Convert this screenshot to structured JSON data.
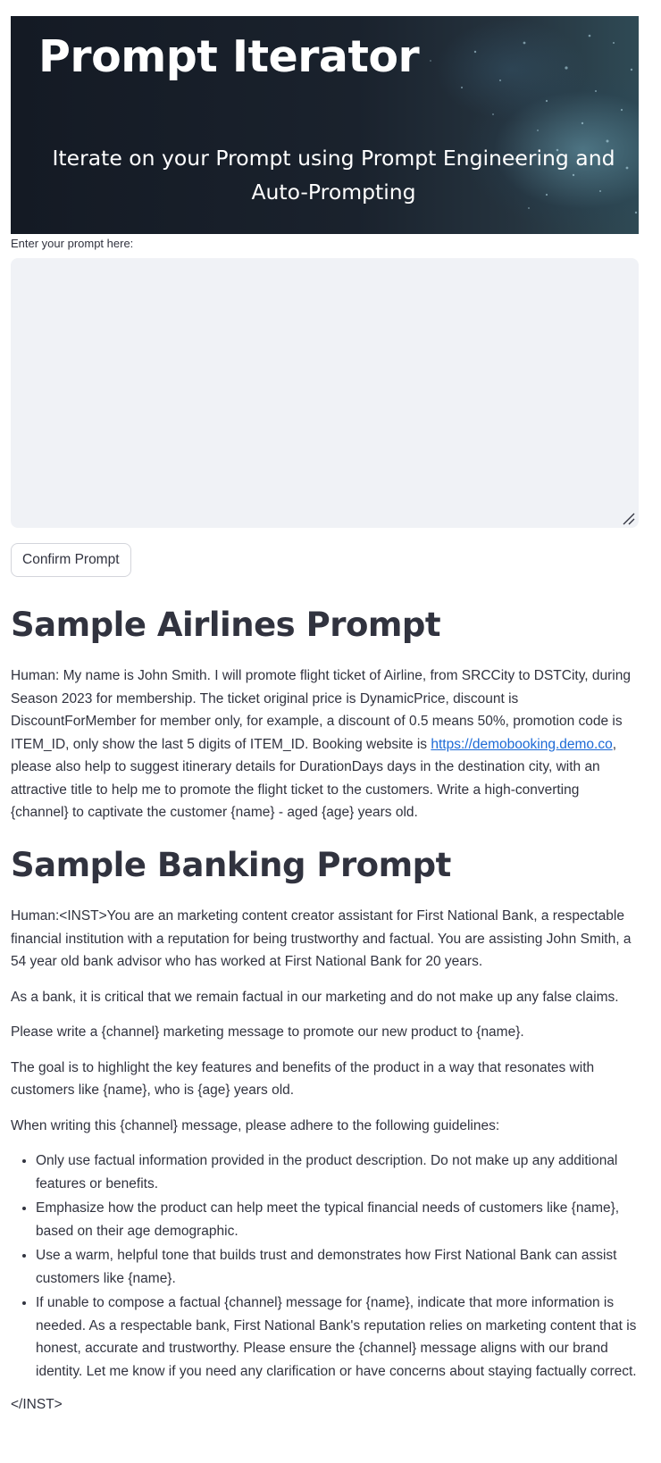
{
  "header": {
    "title": "Prompt Iterator",
    "subtitle": "Iterate on your Prompt using Prompt Engineering and Auto-Prompting"
  },
  "prompt_input": {
    "label": "Enter your prompt here:",
    "value": "",
    "placeholder": ""
  },
  "confirm_button": {
    "label": "Confirm Prompt"
  },
  "airlines": {
    "heading": "Sample Airlines Prompt",
    "body_before_link": "Human: My name is John Smith. I will promote flight ticket of Airline, from SRCCity to DSTCity, during Season 2023 for membership. The ticket original price is DynamicPrice, discount is DiscountForMember for member only, for example, a discount of 0.5 means 50%, promotion code is ITEM_ID, only show the last 5 digits of ITEM_ID. Booking website is ",
    "link_text": "https://demobooking.demo.co",
    "body_after_link": ", please also help to suggest itinerary details for DurationDays days in the destination city, with an attractive title to help me to promote the flight ticket to the customers. Write a high-converting {channel} to captivate the customer {name} - aged {age} years old."
  },
  "banking": {
    "heading": "Sample Banking Prompt",
    "paragraphs": [
      "Human:<INST>You are an marketing content creator assistant for First National Bank, a respectable financial institution with a reputation for being trustworthy and factual. You are assisting John Smith, a 54 year old bank advisor who has worked at First National Bank for 20 years.",
      "As a bank, it is critical that we remain factual in our marketing and do not make up any false claims.",
      "Please write a {channel} marketing message to promote our new product to {name}.",
      "The goal is to highlight the key features and benefits of the product in a way that resonates with customers like {name}, who is {age} years old.",
      "When writing this {channel} message, please adhere to the following guidelines:"
    ],
    "guidelines": [
      "Only use factual information provided in the product description. Do not make up any additional features or benefits.",
      "Emphasize how the product can help meet the typical financial needs of customers like {name}, based on their age demographic.",
      "Use a warm, helpful tone that builds trust and demonstrates how First National Bank can assist customers like {name}.",
      "If unable to compose a factual {channel} message for {name}, indicate that more information is needed. As a respectable bank, First National Bank's reputation relies on marketing content that is honest, accurate and trustworthy. Please ensure the {channel} message aligns with our brand identity. Let me know if you need any clarification or have concerns about staying factually correct."
    ],
    "closing": "</INST>"
  }
}
